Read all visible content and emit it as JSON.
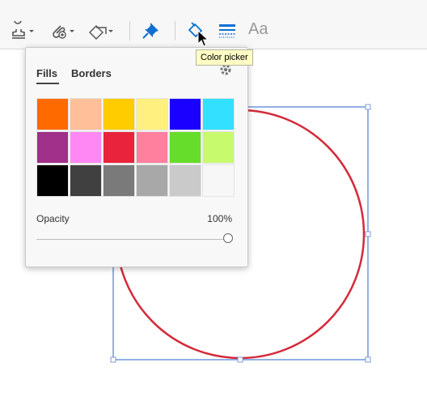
{
  "toolbar": {
    "tools": [
      {
        "name": "stamp-tool-icon"
      },
      {
        "name": "attach-file-tool-icon"
      },
      {
        "name": "shapes-tool-icon"
      },
      {
        "name": "pin-icon"
      },
      {
        "name": "fill-color-icon"
      },
      {
        "name": "line-style-icon"
      }
    ],
    "text_style_label": "Aa"
  },
  "tooltip": {
    "text": "Color picker"
  },
  "color_panel": {
    "tabs": [
      {
        "label": "Fills",
        "active": true
      },
      {
        "label": "Borders",
        "active": false
      }
    ],
    "swatches": [
      "#ff6a00",
      "#ffbf99",
      "#ffcc00",
      "#fff07f",
      "#1a00ff",
      "#33e0ff",
      "#a0308a",
      "#ff88f5",
      "#e8233b",
      "#ff7f9f",
      "#66dd2a",
      "#c8fa6e",
      "#000000",
      "#404040",
      "#7a7a7a",
      "#a8a8a8",
      "#cacaca",
      "#f7f7f7"
    ],
    "opacity_label": "Opacity",
    "opacity_value": "100%",
    "opacity_fraction": 1.0
  },
  "colors": {
    "accent": "#0d6fd1",
    "shape_stroke": "#d42a3a",
    "selection": "#4a7bd1"
  }
}
